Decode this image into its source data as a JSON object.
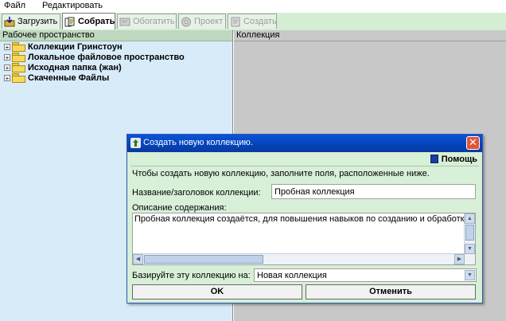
{
  "menu": {
    "file": "Файл",
    "edit": "Редактировать"
  },
  "tabs": [
    {
      "label": "Загрузить",
      "icon": "download-icon",
      "state": "normal"
    },
    {
      "label": "Собрать",
      "icon": "gather-icon",
      "state": "active"
    },
    {
      "label": "Обогатить",
      "icon": "enrich-icon",
      "state": "disabled"
    },
    {
      "label": "Проект",
      "icon": "design-icon",
      "state": "disabled"
    },
    {
      "label": "Создать",
      "icon": "create-icon",
      "state": "disabled"
    }
  ],
  "workspace": {
    "header": "Рабочее пространство",
    "items": [
      {
        "label": "Коллекции Гринстоун"
      },
      {
        "label": "Локальное файловое пространство"
      },
      {
        "label": "Исходная папка (жан)"
      },
      {
        "label": "Скаченные Файлы"
      }
    ]
  },
  "collection": {
    "header": "Коллекция"
  },
  "dialog": {
    "title": "Создать новую коллекцию.",
    "help": "Помощь",
    "intro": "Чтобы создать новую коллекцию, заполните поля, расположенные ниже.",
    "name_label": "Название/заголовок  коллекции:",
    "name_value": "Пробная коллекция",
    "desc_label": "Описание содержания:",
    "desc_value": "Пробная коллекция создаётся, для повышения навыков по созданию и обработке",
    "base_label": "Базируйте эту коллекцию на:",
    "base_value": "Новая коллекция",
    "ok": "OK",
    "cancel": "Отменить"
  },
  "colors": {
    "tab_bar": "#d4eed4",
    "workspace": "#d8ebf8",
    "dialog_bg": "#d8efd8",
    "titlebar": "#0a54d8",
    "close": "#e0553a"
  }
}
